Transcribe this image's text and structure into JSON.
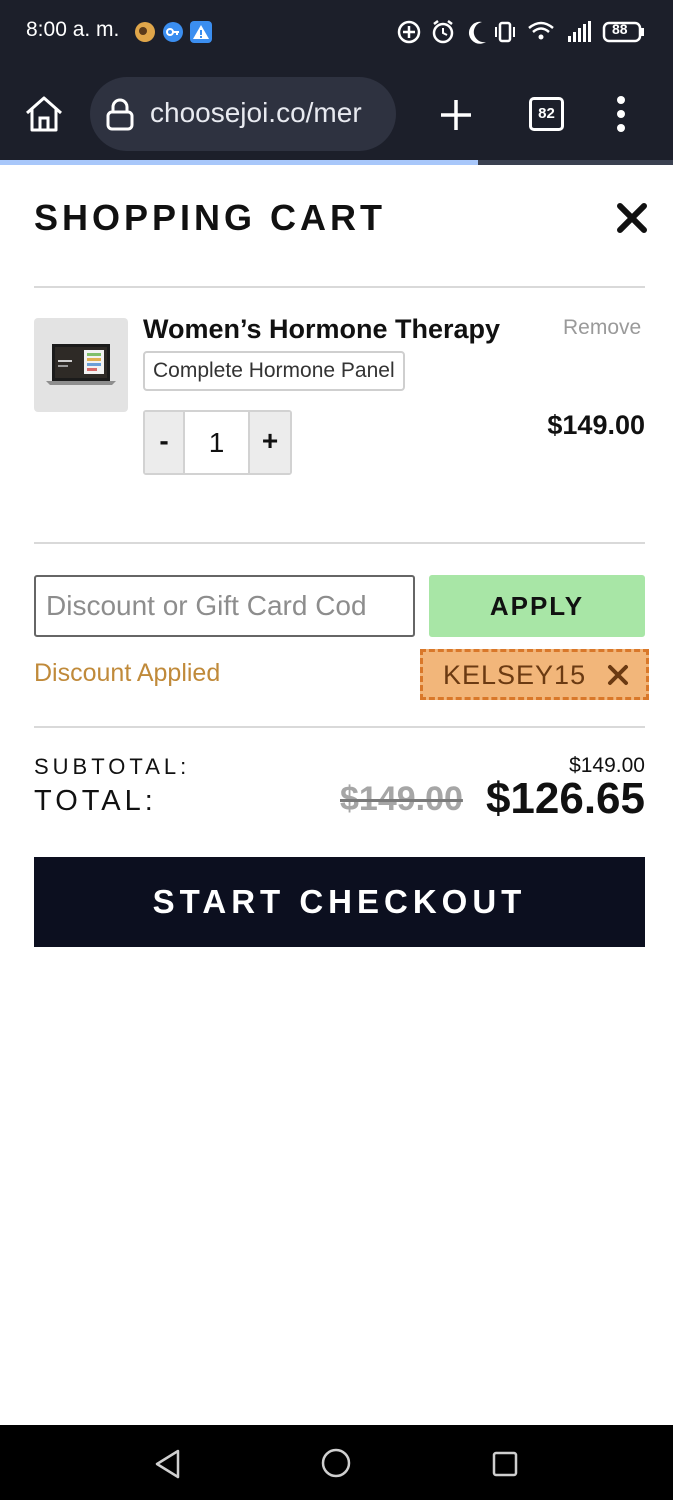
{
  "status_bar": {
    "time": "8:00 a. m.",
    "battery": "88"
  },
  "browser": {
    "url": "choosejoi.co/mer",
    "tab_count": "82",
    "load_progress": 0.71
  },
  "cart": {
    "title": "SHOPPING CART",
    "item": {
      "name": "Women’s Hormone Therapy",
      "variant": "Complete Hormone Panel",
      "remove_label": "Remove",
      "qty_minus": "-",
      "qty_plus": "+",
      "quantity": "1",
      "price": "$149.00"
    },
    "discount": {
      "placeholder": "Discount or Gift Card Cod",
      "apply_label": "APPLY",
      "status": "Discount Applied",
      "code": "KELSEY15"
    },
    "totals": {
      "subtotal_label": "SUBTOTAL:",
      "subtotal_value": "$149.00",
      "total_label": "TOTAL:",
      "total_old": "$149.00",
      "total_new": "$126.65"
    },
    "checkout_label": "START CHECKOUT"
  },
  "colors": {
    "apply_bg": "#a8e6a6",
    "coupon_bg": "#f2b67a",
    "coupon_border": "#d9782a",
    "checkout_bg": "#0c0f1f",
    "discount_text": "#c08a3a"
  }
}
